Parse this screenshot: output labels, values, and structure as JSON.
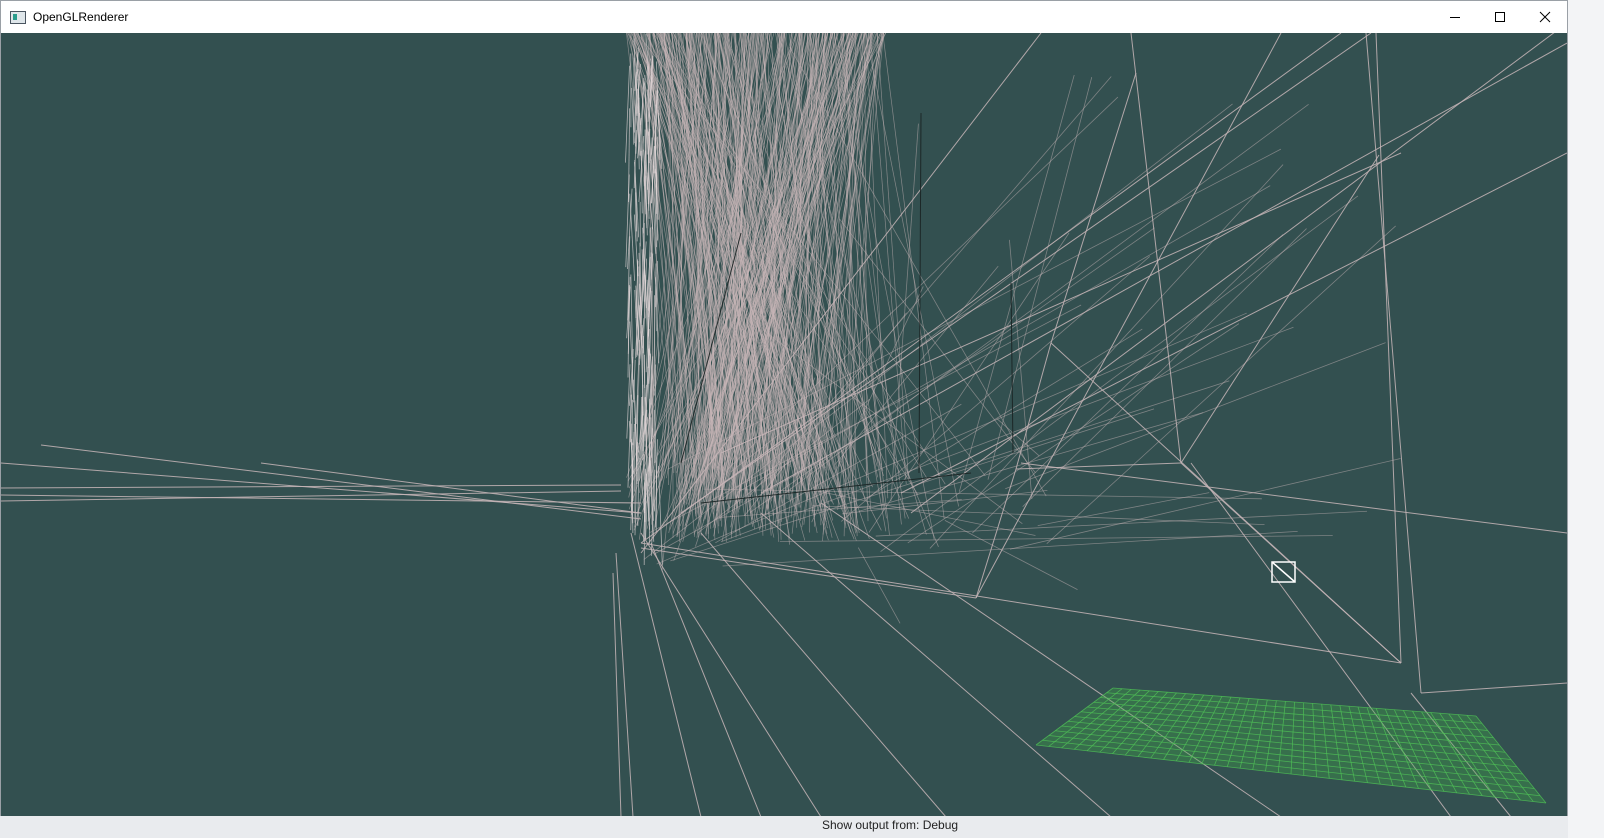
{
  "window": {
    "title": "OpenGLRenderer",
    "controls": {
      "minimize": "minimize-icon",
      "maximize": "maximize-icon",
      "close": "close-icon"
    }
  },
  "viewport": {
    "clear_color": "#335050",
    "wireframe_color": "#c8b6b8",
    "plane_color": "#3fa846",
    "cursor": "crosshair-box-icon"
  },
  "background_window": {
    "status_text": "Show output from: Debug"
  }
}
